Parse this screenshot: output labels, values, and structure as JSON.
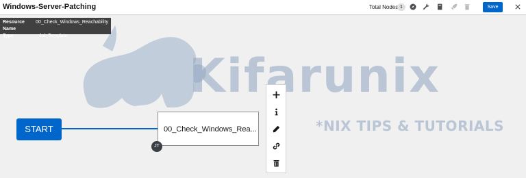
{
  "header": {
    "title": "Windows-Server-Patching",
    "total_nodes_label": "Total Nodes",
    "total_nodes_count": "1",
    "icons": [
      "compass-icon",
      "wrench-icon",
      "book-icon",
      "rocket-icon",
      "trash-icon"
    ],
    "save_label": "Save",
    "close_icon": "close-icon"
  },
  "tooltip": {
    "resource_name_label": "Resource Name",
    "resource_name_value": "00_Check_Windows_Reachability",
    "type_label": "Type",
    "type_value": "Job Template"
  },
  "watermark": {
    "brand": "Kifarunix",
    "tagline": "*NIX TIPS & TUTORIALS"
  },
  "workflow": {
    "start_label": "START",
    "node_label": "00_Check_Windows_Rea...",
    "node_badge": "JT"
  },
  "node_toolbar": {
    "icons": [
      "plus-icon",
      "info-icon",
      "pencil-icon",
      "link-icon",
      "trash-icon"
    ]
  },
  "colors": {
    "accent": "#0066cc",
    "tooltip_bg": "#404040",
    "badge_bg": "#393f44",
    "watermark": "#8fa3bf"
  }
}
